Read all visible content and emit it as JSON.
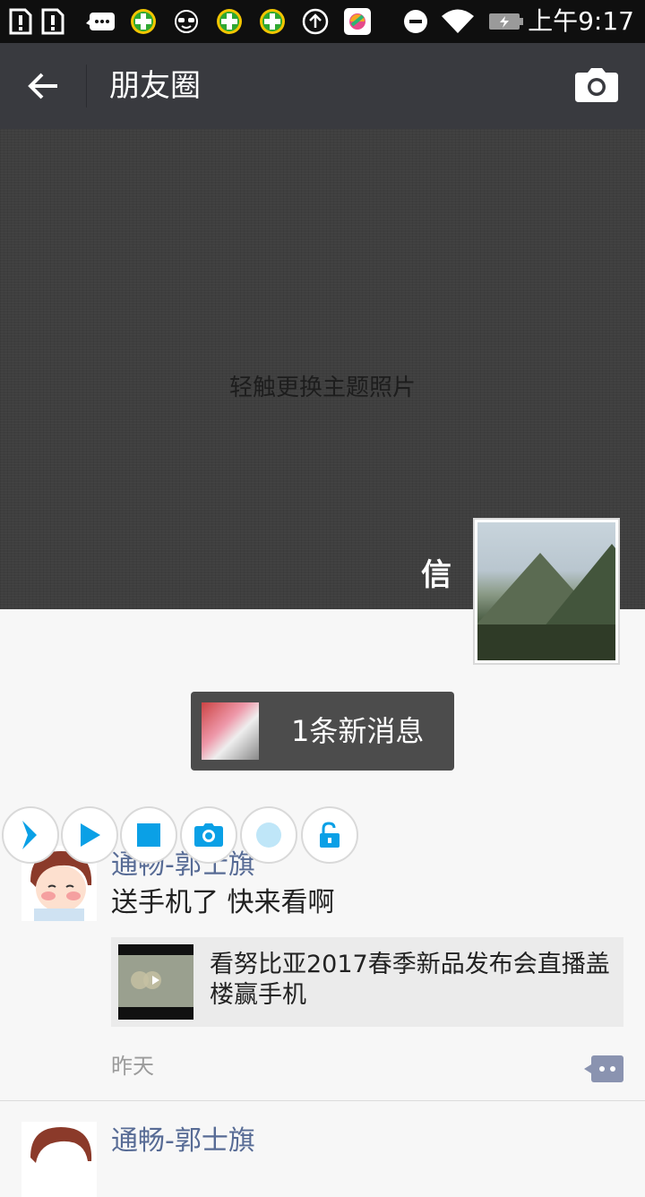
{
  "status_bar": {
    "time": "上午9:17",
    "icons": [
      "sim-alert-icon",
      "sim-alert-icon",
      "chat-bubble-icon",
      "green-plus-icon",
      "sunglasses-face-icon",
      "green-plus-icon",
      "green-plus-icon",
      "upload-icon",
      "app-store-icon",
      "do-not-disturb-icon",
      "wifi-icon",
      "battery-icon"
    ]
  },
  "app_bar": {
    "title": "朋友圈",
    "back_icon": "arrow-left-icon",
    "camera_icon": "camera-icon"
  },
  "cover": {
    "hint": "轻触更换主题照片",
    "nickname": "信"
  },
  "new_message": {
    "label": "1条新消息"
  },
  "floating_toolbar": {
    "buttons": [
      "chevron-right-icon",
      "play-icon",
      "stop-icon",
      "camera-icon",
      "record-dot-icon",
      "unlock-icon"
    ],
    "accent": "#0aa0e6"
  },
  "posts": [
    {
      "author": "通畅-郭士旗",
      "text": "送手机了 快来看啊",
      "link_title": "看努比亚2017春季新品发布会直播盖楼赢手机",
      "time": "昨天"
    },
    {
      "author": "通畅-郭士旗"
    }
  ],
  "colors": {
    "app_bar": "#393a3f",
    "name_link": "#576b95",
    "status_bar": "#0f0f0f"
  }
}
